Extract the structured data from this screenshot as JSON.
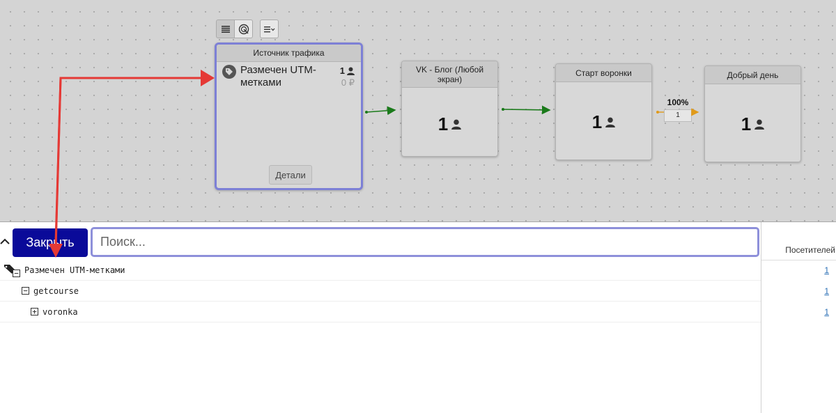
{
  "toolbar": {
    "list_view_icon": "list-icon",
    "radar_view_icon": "radar-icon",
    "menu_icon": "menu-dropdown-icon"
  },
  "nodes": {
    "source": {
      "title": "Источник трафика",
      "item_label": "Размечен UTM-метками",
      "count": "1",
      "revenue": "0 ₽",
      "details_button": "Детали"
    },
    "vk": {
      "title": "VK - Блог (Любой экран)",
      "count": "1"
    },
    "start": {
      "title": "Старт воронки",
      "count": "1"
    },
    "hello": {
      "title": "Добрый день",
      "count": "1"
    }
  },
  "conversion": {
    "percent": "100%",
    "count": "1"
  },
  "panel": {
    "close_label": "Закрыть",
    "search_placeholder": "Поиск...",
    "visitors_header": "Посетителей",
    "rows": [
      {
        "label": "Размечен UTM-метками",
        "value": "1",
        "toggle": "−"
      },
      {
        "label": "getcourse",
        "value": "1",
        "toggle": "−"
      },
      {
        "label": "voronka",
        "value": "1",
        "toggle": "+"
      }
    ]
  },
  "colors": {
    "selected_border": "#7d80d6",
    "close_button": "#0a0a99",
    "annotation_arrow": "#e53935",
    "flow_arrow_green": "#1a7a1a",
    "flow_arrow_orange": "#e09a1a",
    "link": "#2a6fb5"
  }
}
